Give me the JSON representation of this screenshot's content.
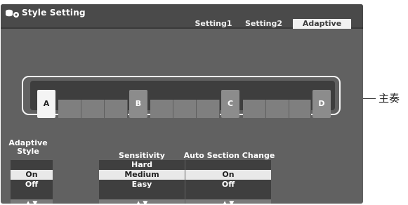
{
  "title": "Style Setting",
  "tabs": [
    {
      "label": "Setting1",
      "active": false
    },
    {
      "label": "Setting2",
      "active": false
    },
    {
      "label": "Adaptive",
      "active": true
    }
  ],
  "sections": {
    "a": "A",
    "b": "B",
    "c": "C",
    "d": "D",
    "selected": "A"
  },
  "adaptive_style": {
    "label": "Adaptive\nStyle",
    "options": [
      "On",
      "Off"
    ],
    "selected": "On"
  },
  "sensitivity": {
    "label": "Sensitivity",
    "options": [
      "Hard",
      "Medium",
      "Easy"
    ],
    "selected": "Medium"
  },
  "auto_section_change": {
    "label": "Auto Section Change",
    "options": [
      "On",
      "Off"
    ],
    "selected": "On"
  },
  "arrows": "▲ ▼",
  "callout": "主奏",
  "colors": {
    "screen_bg": "#616161",
    "titlebar_bg": "#4a4a4a",
    "highlight": "#e9e9e9"
  }
}
